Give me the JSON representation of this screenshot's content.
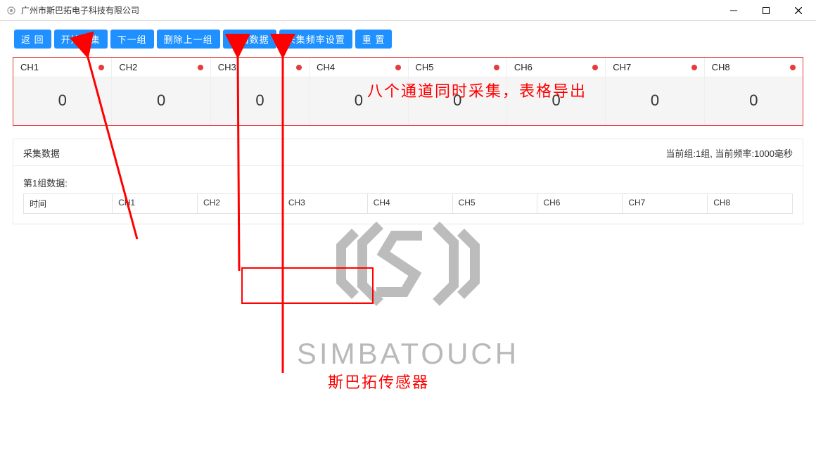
{
  "window": {
    "title": "广州市斯巴拓电子科技有限公司"
  },
  "toolbar": {
    "back": "返 回",
    "start": "开始采集",
    "next": "下一组",
    "delete_prev": "删除上一组",
    "export": "导出数据",
    "freq": "采集频率设置",
    "reset": "重 置"
  },
  "channels": [
    {
      "label": "CH1",
      "value": "0"
    },
    {
      "label": "CH2",
      "value": "0"
    },
    {
      "label": "CH3",
      "value": "0"
    },
    {
      "label": "CH4",
      "value": "0"
    },
    {
      "label": "CH5",
      "value": "0"
    },
    {
      "label": "CH6",
      "value": "0"
    },
    {
      "label": "CH7",
      "value": "0"
    },
    {
      "label": "CH8",
      "value": "0"
    }
  ],
  "collect": {
    "title": "采集数据",
    "status": "当前组:1组, 当前频率:1000毫秒",
    "group_label": "第1组数据:",
    "headers": [
      "时间",
      "CH1",
      "CH2",
      "CH3",
      "CH4",
      "CH5",
      "CH6",
      "CH7",
      "CH8"
    ]
  },
  "watermark": {
    "brand": "SIMBATOUCH"
  },
  "annotations": {
    "text1": "八个通道同时采集，表格导出",
    "text2": "斯巴拓传感器"
  }
}
